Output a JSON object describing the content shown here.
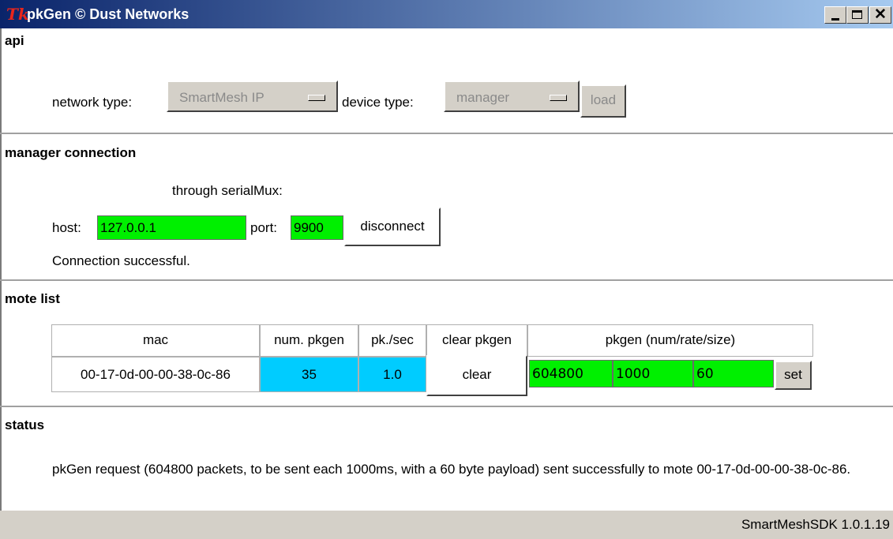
{
  "window": {
    "title": "pkGen © Dust Networks",
    "tk_icon": "Tk"
  },
  "api": {
    "section_title": "api",
    "network_type_label": "network type:",
    "network_type_value": "SmartMesh IP",
    "device_type_label": "device type:",
    "device_type_value": "manager",
    "load_label": "load"
  },
  "manager": {
    "section_title": "manager connection",
    "through_label": "through serialMux:",
    "host_label": "host:",
    "host_value": "127.0.0.1",
    "port_label": "port:",
    "port_value": "9900",
    "disconnect_label": "disconnect",
    "connection_status": "Connection successful."
  },
  "motes": {
    "section_title": "mote list",
    "headers": [
      "mac",
      "num. pkgen",
      "pk./sec",
      "clear pkgen",
      "pkgen (num/rate/size)"
    ],
    "rows": [
      {
        "mac": "00-17-0d-00-00-38-0c-86",
        "num_pkgen": "35",
        "pk_sec": "1.0",
        "clear_label": "clear",
        "pkgen_num": "604800",
        "pkgen_rate": "1000",
        "pkgen_size": "60",
        "set_label": "set"
      }
    ]
  },
  "status": {
    "section_title": "status",
    "message": "pkGen request (604800 packets, to be sent each 1000ms, with a 60 byte payload) sent successfully to mote 00-17-0d-00-00-38-0c-86."
  },
  "footer": {
    "version": "SmartMeshSDK 1.0.1.19"
  },
  "colors": {
    "entry_green": "#00f000",
    "cell_blue": "#00ccff",
    "titlebar": "#0a246a"
  }
}
